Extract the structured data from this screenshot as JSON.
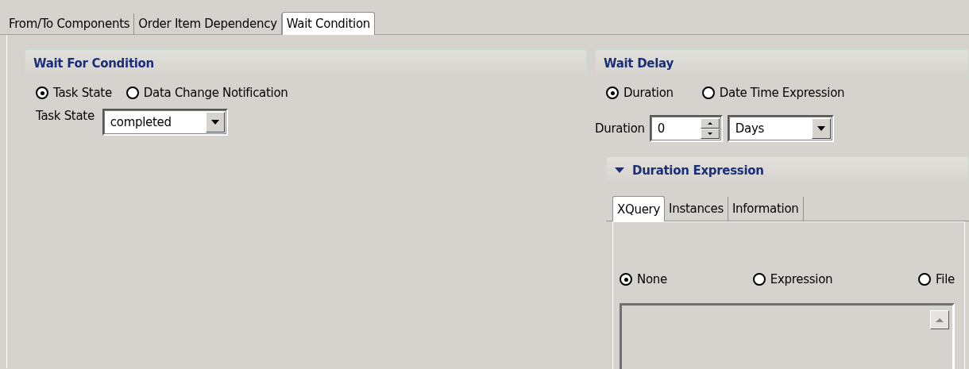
{
  "tabs": [
    {
      "label": "From/To Components",
      "selected": false
    },
    {
      "label": "Order Item Dependency",
      "selected": false
    },
    {
      "label": "Wait Condition",
      "selected": true
    }
  ],
  "wait_for_condition": {
    "title": "Wait For Condition",
    "options": [
      {
        "label": "Task State",
        "selected": true
      },
      {
        "label": "Data Change Notification",
        "selected": false
      }
    ],
    "task_state": {
      "label": "Task State",
      "value": "completed"
    }
  },
  "wait_delay": {
    "title": "Wait Delay",
    "options": [
      {
        "label": "Duration",
        "selected": true
      },
      {
        "label": "Date Time Expression",
        "selected": false
      }
    ],
    "duration": {
      "label": "Duration",
      "value": "0",
      "unit": "Days"
    },
    "duration_expression": {
      "title": "Duration Expression",
      "expanded": true,
      "tabs": [
        {
          "label": "XQuery",
          "selected": true
        },
        {
          "label": "Instances",
          "selected": false
        },
        {
          "label": "Information",
          "selected": false
        }
      ],
      "options": [
        {
          "label": "None",
          "selected": true
        },
        {
          "label": "Expression",
          "selected": false
        },
        {
          "label": "File",
          "selected": false
        }
      ]
    }
  }
}
